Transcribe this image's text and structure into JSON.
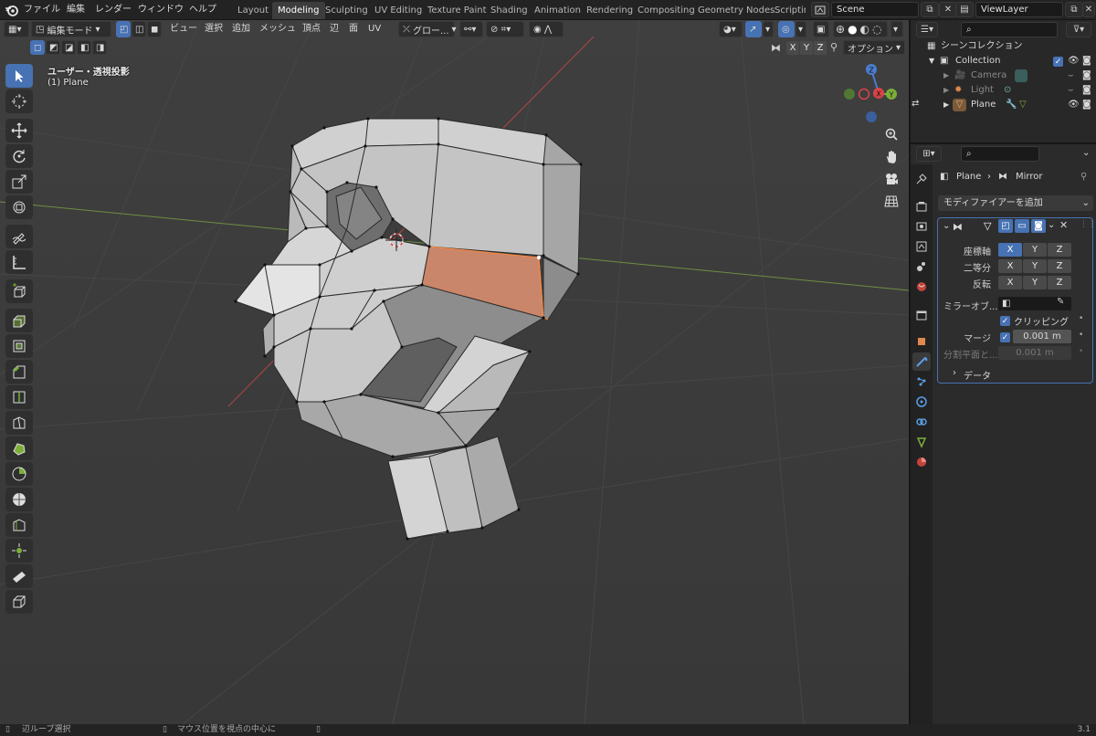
{
  "topbar": {
    "menus": [
      "ファイル",
      "編集",
      "レンダー",
      "ウィンドウ",
      "ヘルプ"
    ],
    "workspace_tabs": [
      {
        "label": "Layout",
        "active": false
      },
      {
        "label": "Modeling",
        "active": true
      },
      {
        "label": "Sculpting",
        "active": false
      },
      {
        "label": "UV Editing",
        "active": false
      },
      {
        "label": "Texture Paint",
        "active": false
      },
      {
        "label": "Shading",
        "active": false
      },
      {
        "label": "Animation",
        "active": false
      },
      {
        "label": "Rendering",
        "active": false
      },
      {
        "label": "Compositing",
        "active": false
      },
      {
        "label": "Geometry Nodes",
        "active": false
      },
      {
        "label": "Scriptir",
        "active": false
      }
    ],
    "scene": "Scene",
    "view_layer": "ViewLayer"
  },
  "viewport_header": {
    "mode": "編集モード",
    "menus": [
      "ビュー",
      "選択",
      "追加",
      "メッシュ",
      "頂点",
      "辺",
      "面",
      "UV"
    ],
    "transform_orientation": "グロー...",
    "axes": [
      "X",
      "Y",
      "Z"
    ],
    "options": "オプション"
  },
  "viewport": {
    "view_name": "ユーザー・透視投影",
    "object_name": "(1) Plane"
  },
  "gizmo": {
    "x": "X",
    "y": "Y",
    "z": "Z"
  },
  "outliner": {
    "title": "シーンコレクション",
    "items": [
      {
        "label": "Collection",
        "indent": 1
      },
      {
        "label": "Camera",
        "indent": 2
      },
      {
        "label": "Light",
        "indent": 2
      },
      {
        "label": "Plane",
        "indent": 2
      }
    ]
  },
  "properties": {
    "breadcrumb_object": "Plane",
    "breadcrumb_modifier": "Mirror",
    "add_modifier": "モディファイアーを追加",
    "modifier": {
      "axis_label": "座標軸",
      "bisect_label": "二等分",
      "flip_label": "反転",
      "axis_states": [
        true,
        false,
        false
      ],
      "bisect_states": [
        false,
        false,
        false
      ],
      "flip_states": [
        false,
        false,
        false
      ],
      "mirror_object_label": "ミラーオブ...",
      "clipping_label": "クリッピング",
      "clipping": true,
      "merge_label": "マージ",
      "merge": true,
      "merge_value": "0.001 m",
      "bisect_distance_label": "分割平面と...",
      "bisect_distance_value": "0.001 m",
      "data_label": "データ"
    }
  },
  "statusbar": {
    "left": "辺ループ選択",
    "middle": "マウス位置を視点の中心に",
    "version": "3.1"
  },
  "colors": {
    "accent": "#4772b3",
    "selected_face": "#d0886a",
    "selected_edge": "#ff8a3d",
    "x_axis": "#d94448",
    "y_axis": "#7cae3a",
    "z_axis": "#4a7dd0"
  }
}
